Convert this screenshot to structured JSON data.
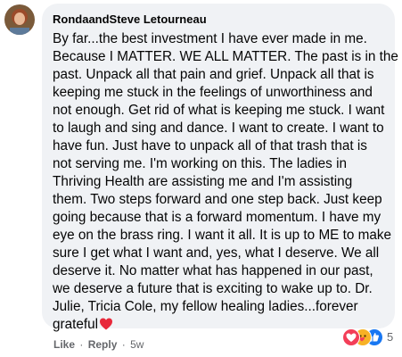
{
  "comment": {
    "author": "RondaandSteve Letourneau",
    "lines": [
      "By far...the best investment I have ever made in me.",
      "Because I MATTER. WE ALL MATTER. The past is in the",
      "past. Unpack all that pain and grief. Unpack all that is",
      "keeping me stuck in the feelings of unworthiness and",
      "not enough. Get rid of what is keeping me stuck. I want",
      "to laugh and sing and dance. I want to create. I want to",
      "have fun. Just have to unpack all of that trash that is",
      "not serving me. I'm working on this. The ladies in",
      "Thriving Health are assisting me and I'm assisting",
      "them. Two steps forward and one step back. Just keep",
      "going because that is a forward momentum. I have my",
      "eye on the brass ring. I want it all. It is up to ME to make",
      "sure I get what I want and, yes, what I deserve. We all",
      "deserve it. No matter what has happened in our past,",
      "we deserve a future that is exciting to wake up to. Dr.",
      "Julie, Tricia Cole, my fellow healing ladies...forever",
      "grateful"
    ],
    "trailing_icon": "red-heart-emoji-icon"
  },
  "actions": {
    "like": "Like",
    "separator": "·",
    "reply": "Reply",
    "time": "5w"
  },
  "reactions": {
    "icons": [
      "love-reaction-icon",
      "care-reaction-icon",
      "like-reaction-icon"
    ],
    "count": "5"
  },
  "colors": {
    "bubble": "#f0f2f5",
    "text": "#050505",
    "meta": "#65676b",
    "like_blue": "#1877f2",
    "love_red": "#f33e58"
  }
}
